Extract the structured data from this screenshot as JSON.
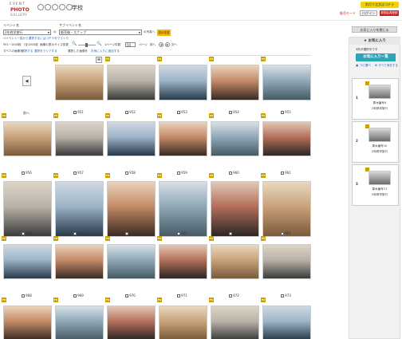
{
  "header": {
    "logo_top": "EVENT",
    "logo_mid": "PHOTO",
    "logo_bottom": "GALLERY",
    "school_name": "学校",
    "order_button": "前月で注文はコチラ",
    "mode_link": "販売モード",
    "login_button": "ログイン",
    "register_button": "新規会員登録"
  },
  "filter": {
    "event_label": "イベント名",
    "event_value": "2年修学旅行",
    "sub_event_label": "サブイベント名",
    "sub_event_value": "販売後・スナップ",
    "of_text": "の",
    "photo_text": "の写真へ",
    "show_button": "表示変更",
    "hint_link": "⇒イベント一覧から選択するにはコチラをクリック",
    "count_text": "951~1000枚 （全1000枚",
    "size_label": "画像の表示サイズ変更",
    "perpage_label": "1ページ件数",
    "perpage_value": "50",
    "page_label": "ページ",
    "prev_label": "前へ",
    "next_label": "次へ",
    "select_all_prefix": "すべての画像を",
    "select_all_link": "選択する",
    "deselect_all_link": "選択をクリアする",
    "selected_prefix": "選択した画像を",
    "add_fav_link": "お気に入りに追加する"
  },
  "grid": {
    "prev_button": "前へ",
    "fav_badge": "FV",
    "photos": [
      {
        "id": "951"
      },
      {
        "id": "952"
      },
      {
        "id": "953"
      },
      {
        "id": "954"
      },
      {
        "id": "955"
      },
      {
        "id": "956"
      },
      {
        "id": "957"
      },
      {
        "id": "958"
      },
      {
        "id": "959"
      },
      {
        "id": "960"
      },
      {
        "id": "961"
      },
      {
        "id": "962"
      },
      {
        "id": "963"
      },
      {
        "id": "964"
      },
      {
        "id": "965"
      },
      {
        "id": "966"
      },
      {
        "id": "967"
      },
      {
        "id": "968"
      },
      {
        "id": "969"
      },
      {
        "id": "970"
      },
      {
        "id": "971"
      },
      {
        "id": "972"
      },
      {
        "id": "973"
      },
      {
        "id": ""
      },
      {
        "id": ""
      },
      {
        "id": ""
      },
      {
        "id": ""
      },
      {
        "id": ""
      },
      {
        "id": ""
      }
    ]
  },
  "sidebar": {
    "top_button": "お気に入りを閉じる",
    "fav_title": "お気に入り",
    "selected_text": "3件が選択中です",
    "list_button": "お気に入り一覧",
    "select_link": "コピ選べ",
    "clear_link": "すべて消去する",
    "items": [
      {
        "num": "1",
        "line1": "周木番号4",
        "line2": "2年修学旅行"
      },
      {
        "num": "2",
        "line1": "周木番号10",
        "line2": "2年修学旅行"
      },
      {
        "num": "3",
        "line1": "周木番号17",
        "line2": "2年修学旅行"
      }
    ]
  },
  "colors": {
    "accent_yellow": "#f5d300",
    "accent_red": "#cc2222",
    "teal": "#2aa6b8",
    "fav_gold": "#c9a200"
  }
}
